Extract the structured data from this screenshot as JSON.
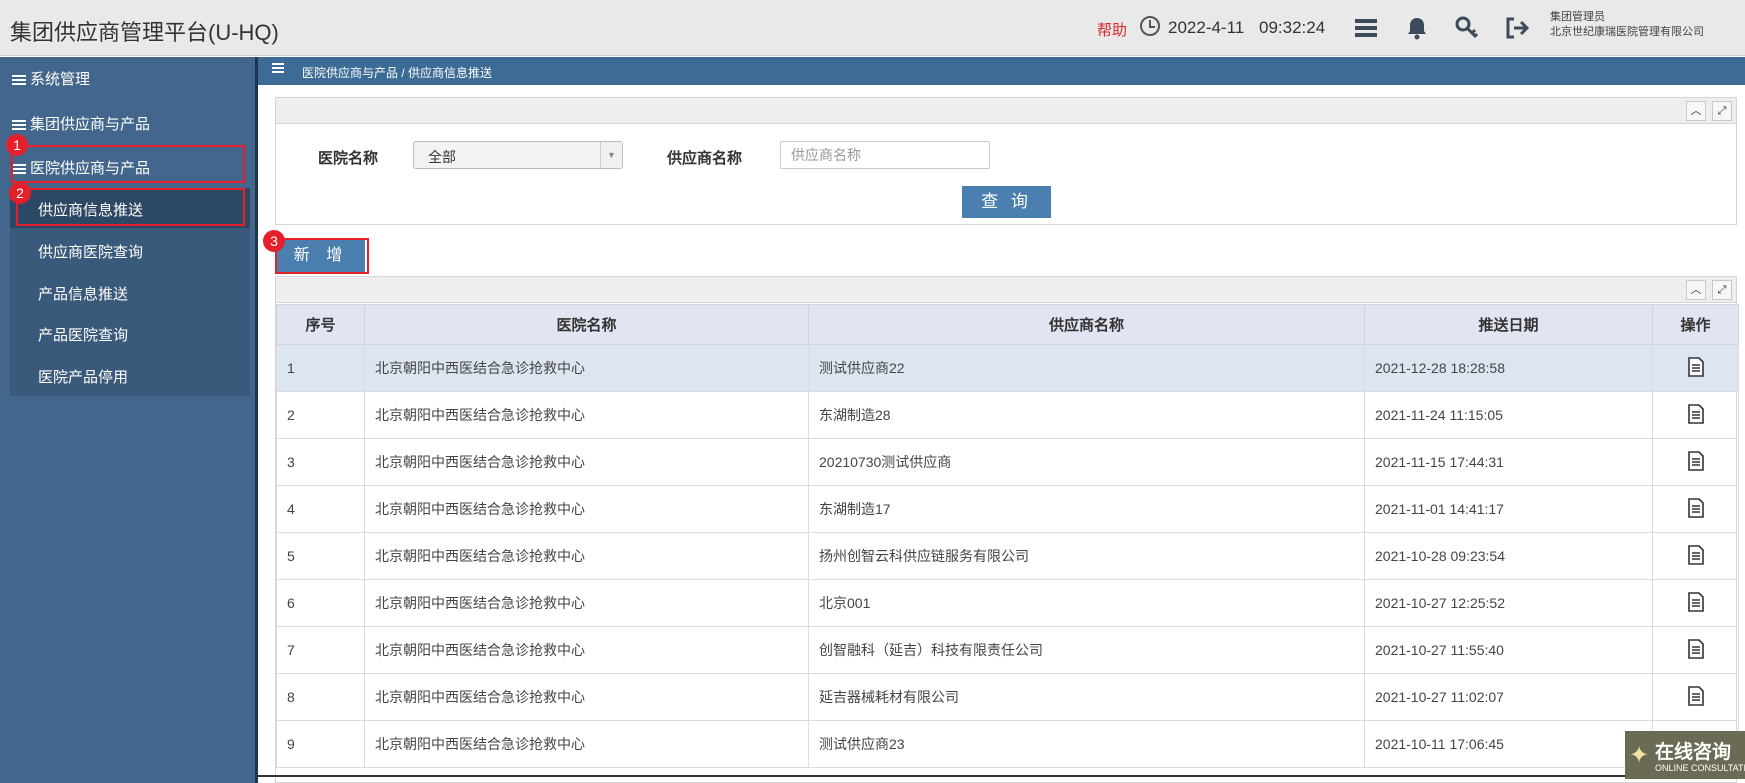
{
  "header": {
    "title": "集团供应商管理平台(U-HQ)",
    "help": "帮助",
    "date": "2022-4-11",
    "time": "09:32:24",
    "user_role": "集团管理员",
    "org": "北京世纪康瑞医院管理有限公司",
    "icons": [
      "clock-icon",
      "list-icon",
      "bell-icon",
      "key-icon",
      "logout-icon"
    ]
  },
  "sidebar": {
    "menus": [
      {
        "label": "系统管理"
      },
      {
        "label": "集团供应商与产品"
      },
      {
        "label": "医院供应商与产品"
      }
    ],
    "submenu": [
      {
        "label": "供应商信息推送"
      },
      {
        "label": "供应商医院查询"
      },
      {
        "label": "产品信息推送"
      },
      {
        "label": "产品医院查询"
      },
      {
        "label": "医院产品停用"
      }
    ]
  },
  "annotations": [
    "1",
    "2",
    "3"
  ],
  "breadcrumb": "医院供应商与产品 / 供应商信息推送",
  "search": {
    "hospital_label": "医院名称",
    "hospital_value": "全部",
    "supplier_label": "供应商名称",
    "supplier_placeholder": "供应商名称",
    "query_button": "查 询"
  },
  "add_button": "新 增",
  "table": {
    "headers": [
      "序号",
      "医院名称",
      "供应商名称",
      "推送日期",
      "操作"
    ],
    "rows": [
      {
        "no": "1",
        "hospital": "北京朝阳中西医结合急诊抢救中心",
        "supplier": "测试供应商22",
        "date": "2021-12-28 18:28:58"
      },
      {
        "no": "2",
        "hospital": "北京朝阳中西医结合急诊抢救中心",
        "supplier": "东湖制造28",
        "date": "2021-11-24 11:15:05"
      },
      {
        "no": "3",
        "hospital": "北京朝阳中西医结合急诊抢救中心",
        "supplier": "20210730测试供应商",
        "date": "2021-11-15 17:44:31"
      },
      {
        "no": "4",
        "hospital": "北京朝阳中西医结合急诊抢救中心",
        "supplier": "东湖制造17",
        "date": "2021-11-01 14:41:17"
      },
      {
        "no": "5",
        "hospital": "北京朝阳中西医结合急诊抢救中心",
        "supplier": "扬州创智云科供应链服务有限公司",
        "date": "2021-10-28 09:23:54"
      },
      {
        "no": "6",
        "hospital": "北京朝阳中西医结合急诊抢救中心",
        "supplier": "北京001",
        "date": "2021-10-27 12:25:52"
      },
      {
        "no": "7",
        "hospital": "北京朝阳中西医结合急诊抢救中心",
        "supplier": "创智融科（延吉）科技有限责任公司",
        "date": "2021-10-27 11:55:40"
      },
      {
        "no": "8",
        "hospital": "北京朝阳中西医结合急诊抢救中心",
        "supplier": "延吉器械耗材有限公司",
        "date": "2021-10-27 11:02:07"
      },
      {
        "no": "9",
        "hospital": "北京朝阳中西医结合急诊抢救中心",
        "supplier": "测试供应商23",
        "date": "2021-10-11 17:06:45"
      }
    ]
  },
  "online_consult": {
    "title": "在线咨询",
    "subtitle": "ONLINE CONSULTATION"
  }
}
